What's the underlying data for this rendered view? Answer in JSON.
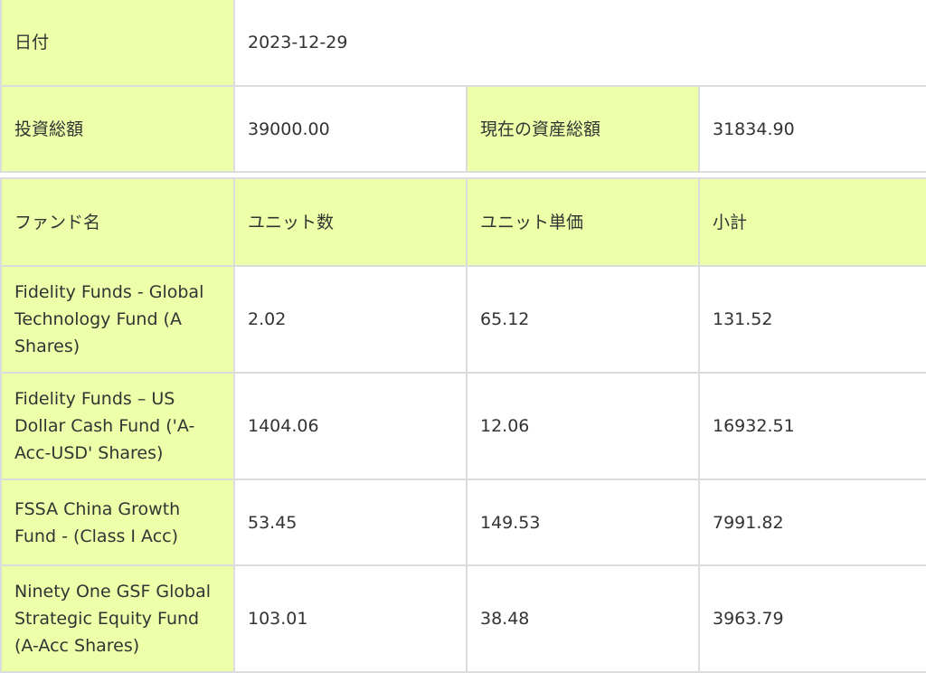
{
  "summary": {
    "date_label": "日付",
    "date_value": "2023-12-29",
    "invest_label": "投資総額",
    "invest_value": "39000.00",
    "assets_label": "現在の資産総額",
    "assets_value": "31834.90"
  },
  "funds": {
    "headers": [
      "ファンド名",
      "ユニット数",
      "ユニット単価",
      "小計"
    ],
    "rows": [
      {
        "name": "Fidelity Funds - Global Technology Fund (A Shares)",
        "units": "2.02",
        "price": "65.12",
        "subtotal": "131.52"
      },
      {
        "name": "Fidelity Funds – US Dollar Cash Fund ('A-Acc-USD' Shares)",
        "units": "1404.06",
        "price": "12.06",
        "subtotal": "16932.51"
      },
      {
        "name": "FSSA China Growth Fund - (Class I Acc)",
        "units": "53.45",
        "price": "149.53",
        "subtotal": "7991.82"
      },
      {
        "name": "Ninety One GSF Global Strategic Equity Fund (A-Acc Shares)",
        "units": "103.01",
        "price": "38.48",
        "subtotal": "3963.79"
      }
    ]
  },
  "colors": {
    "header_bg": "#eeffaa",
    "border": "#dcdcdc",
    "text": "#333333"
  }
}
